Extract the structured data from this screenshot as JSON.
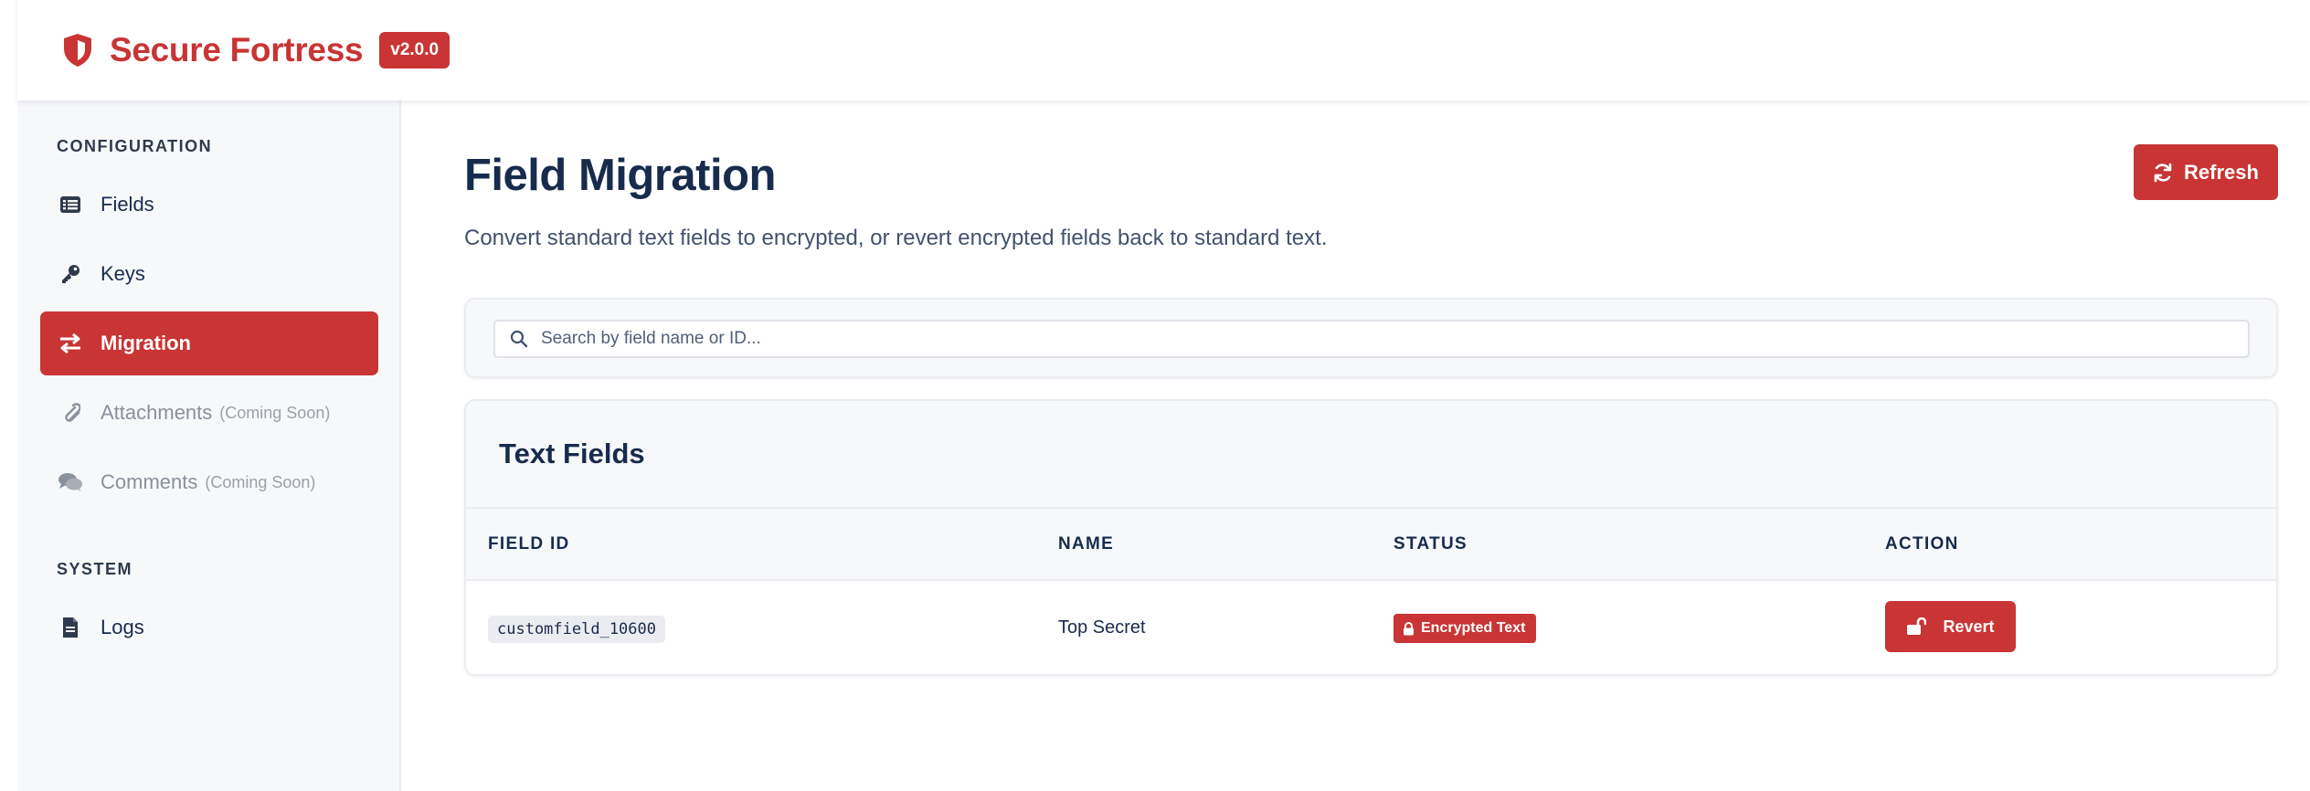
{
  "header": {
    "brand": "Secure Fortress",
    "version": "v2.0.0",
    "accent_color": "#c93434",
    "logo_icon": "shield-icon"
  },
  "sidebar": {
    "configuration_title": "CONFIGURATION",
    "system_title": "SYSTEM",
    "items": [
      {
        "label": "Fields",
        "icon": "list-icon",
        "active": false,
        "disabled": false
      },
      {
        "label": "Keys",
        "icon": "key-icon",
        "active": false,
        "disabled": false
      },
      {
        "label": "Migration",
        "icon": "swap-arrows-icon",
        "active": true,
        "disabled": false
      },
      {
        "label": "Attachments",
        "suffix": "(Coming Soon)",
        "icon": "paperclip-icon",
        "active": false,
        "disabled": true
      },
      {
        "label": "Comments",
        "suffix": "(Coming Soon)",
        "icon": "comments-icon",
        "active": false,
        "disabled": true
      },
      {
        "label": "Logs",
        "icon": "file-icon",
        "active": false,
        "disabled": false
      }
    ]
  },
  "main": {
    "title": "Field Migration",
    "subtitle": "Convert standard text fields to encrypted, or revert encrypted fields back to standard text.",
    "refresh_label": "Refresh",
    "search": {
      "placeholder": "Search by field name or ID...",
      "value": ""
    },
    "table": {
      "title": "Text Fields",
      "columns": [
        "FIELD ID",
        "NAME",
        "STATUS",
        "ACTION"
      ],
      "rows": [
        {
          "field_id": "customfield_10600",
          "name": "Top Secret",
          "status": "Encrypted Text",
          "action": "Revert"
        }
      ]
    }
  }
}
